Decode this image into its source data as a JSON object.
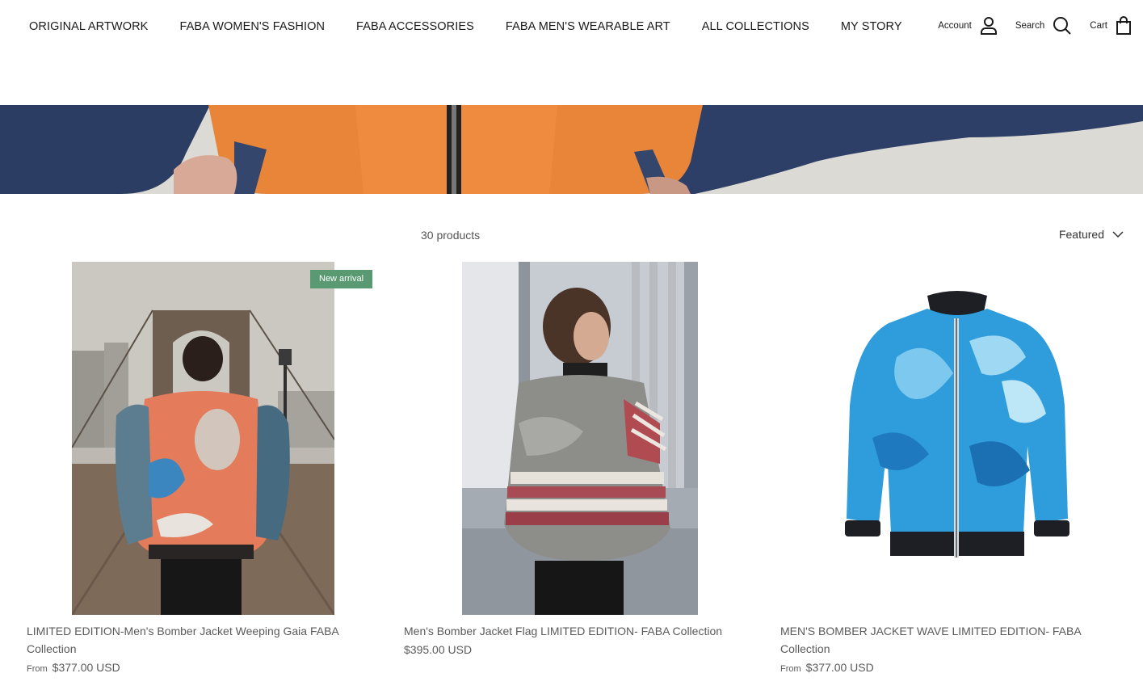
{
  "nav": {
    "items": [
      {
        "label": "ORIGINAL ARTWORK"
      },
      {
        "label": "FABA WOMEN'S FASHION"
      },
      {
        "label": "FABA ACCESSORIES"
      },
      {
        "label": "FABA MEN'S WEARABLE ART"
      },
      {
        "label": "ALL COLLECTIONS"
      },
      {
        "label": "MY STORY"
      }
    ]
  },
  "utils": {
    "account_label": "Account",
    "search_label": "Search",
    "cart_label": "Cart"
  },
  "toolbar": {
    "count": "30 products",
    "sort_label": "Featured"
  },
  "products": [
    {
      "title": "LIMITED EDITION-Men's Bomber Jacket Weeping Gaia FABA Collection",
      "price_prefix": "From",
      "price": "$377.00 USD",
      "badge": "New arrival"
    },
    {
      "title": "Men's Bomber Jacket Flag LIMITED EDITION- FABA Collection",
      "price_prefix": "",
      "price": "$395.00 USD"
    },
    {
      "title": "MEN'S BOMBER JACKET WAVE LIMITED EDITION- FABA Collection",
      "price_prefix": "From",
      "price": "$377.00 USD"
    }
  ],
  "colors": {
    "badge": "#5a9a73",
    "text": "#1a1a1a",
    "muted": "#5a5a5a"
  }
}
